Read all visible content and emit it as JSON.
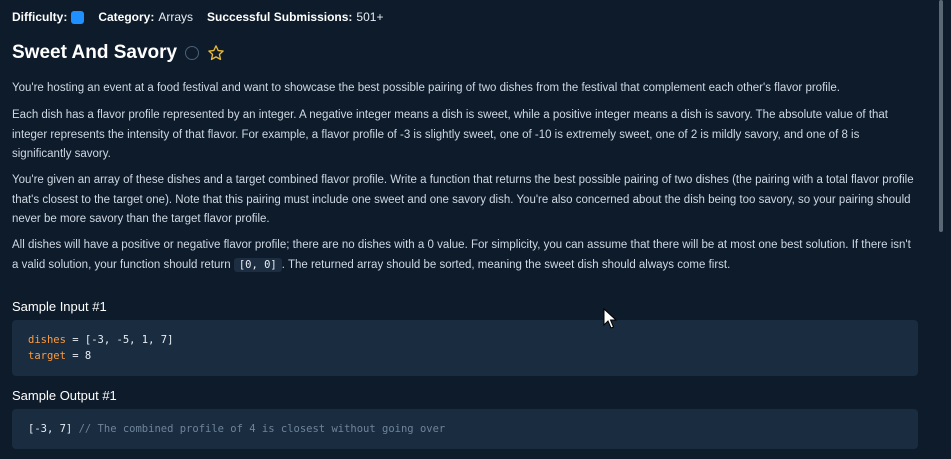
{
  "meta": {
    "difficulty_label": "Difficulty:",
    "difficulty_color": "#1e90ff",
    "category_label": "Category:",
    "category_value": "Arrays",
    "submissions_label": "Successful Submissions:",
    "submissions_value": "501+"
  },
  "title": "Sweet And Savory",
  "paragraphs": {
    "p1": "You're hosting an event at a food festival and want to showcase the best possible pairing of two dishes from the festival that complement each other's flavor profile.",
    "p2": "Each dish has a flavor profile represented by an integer. A negative integer means a dish is sweet, while a positive integer means a dish is savory. The absolute value of that integer represents the intensity of that flavor. For example, a flavor profile of -3 is slightly sweet, one of -10 is extremely sweet, one of 2 is mildly savory, and one of 8 is significantly savory.",
    "p3": "You're given an array of these dishes and a target combined flavor profile. Write a function that returns the best possible pairing of two dishes (the pairing with a total flavor profile that's closest to the target one). Note that this pairing must include one sweet and one savory dish. You're also concerned about the dish being too savory, so your pairing should never be more savory than the target flavor profile.",
    "p4_before": "All dishes will have a positive or negative flavor profile; there are no dishes with a 0 value. For simplicity, you can assume that there will be at most one best solution. If there isn't a valid solution, your function should return ",
    "p4_code": "[0, 0]",
    "p4_after": ". The returned array should be sorted, meaning the sweet dish should always come first."
  },
  "sample_input": {
    "heading": "Sample Input #1",
    "line1_var": "dishes",
    "line1_rest": " = [-3, -5, 1, 7]",
    "line2_var": "target",
    "line2_rest": " = 8"
  },
  "sample_output": {
    "heading": "Sample Output #1",
    "value": "[-3, 7]",
    "comment": " // The combined profile of 4 is closest without going over"
  }
}
